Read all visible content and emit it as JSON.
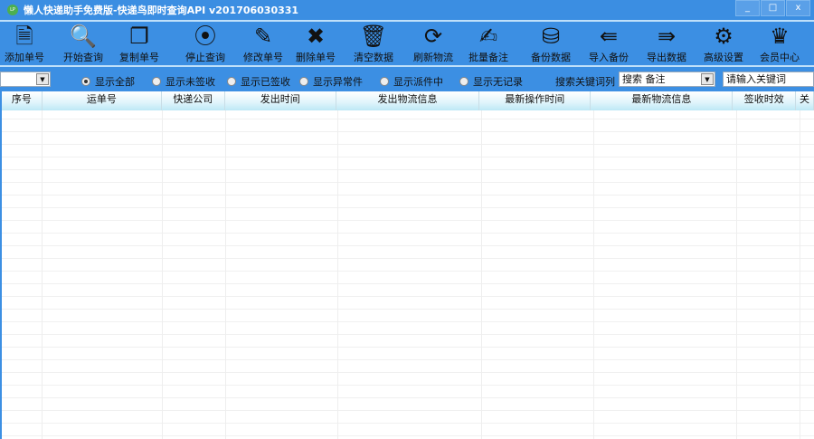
{
  "window": {
    "title": "懒人快递助手免费版-快递鸟即时查询API v201706030331",
    "icon_text": "LP",
    "minimize": "_",
    "maximize": "□",
    "close": "x"
  },
  "toolbar": [
    {
      "label": "添加单号",
      "icon": "add-document-icon",
      "glyph": "🗎"
    },
    {
      "label": "开始查询",
      "icon": "search-icon",
      "glyph": "🔍"
    },
    {
      "label": "复制单号",
      "icon": "copy-icon",
      "glyph": "❐"
    },
    {
      "label": "停止查询",
      "icon": "stop-icon",
      "glyph": "⦿"
    },
    {
      "label": "修改单号",
      "icon": "pencil-icon",
      "glyph": "✎"
    },
    {
      "label": "删除单号",
      "icon": "delete-icon",
      "glyph": "✖"
    },
    {
      "label": "清空数据",
      "icon": "trash-icon",
      "glyph": "🗑"
    },
    {
      "label": "刷新物流",
      "icon": "refresh-icon",
      "glyph": "⟳"
    },
    {
      "label": "批量备注",
      "icon": "note-edit-icon",
      "glyph": "✍"
    },
    {
      "label": "备份数据",
      "icon": "database-backup-icon",
      "glyph": "⛁"
    },
    {
      "label": "导入备份",
      "icon": "import-icon",
      "glyph": "⇚"
    },
    {
      "label": "导出数据",
      "icon": "excel-export-icon",
      "glyph": "⇛"
    },
    {
      "label": "高级设置",
      "icon": "gear-icon",
      "glyph": "⚙"
    },
    {
      "label": "会员中心",
      "icon": "crown-icon",
      "glyph": "♛"
    }
  ],
  "filters": {
    "combo_value": "",
    "radios": [
      {
        "label": "显示全部",
        "checked": true
      },
      {
        "label": "显示未签收",
        "checked": false
      },
      {
        "label": "显示已签收",
        "checked": false
      },
      {
        "label": "显示异常件",
        "checked": false
      },
      {
        "label": "显示派件中",
        "checked": false
      },
      {
        "label": "显示无记录",
        "checked": false
      }
    ],
    "search_column_label": "搜索关键词列",
    "search_column_value": "搜索 备注",
    "keyword_placeholder": "请输入关键词"
  },
  "table": {
    "columns": [
      "序号",
      "运单号",
      "快递公司",
      "发出时间",
      "发出物流信息",
      "最新操作时间",
      "最新物流信息",
      "签收时效",
      "关"
    ],
    "rows": []
  }
}
